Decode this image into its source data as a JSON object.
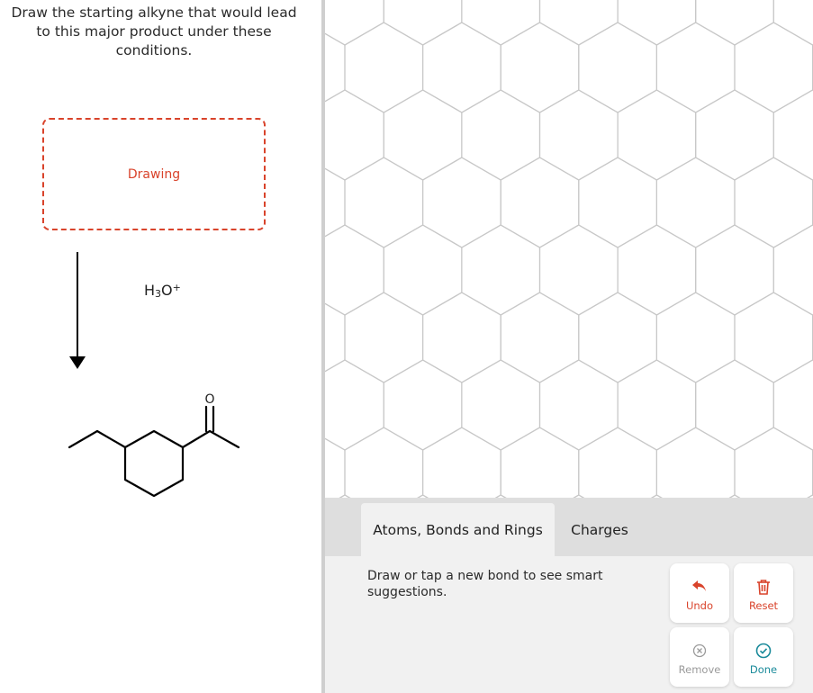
{
  "question": {
    "text": "Draw the starting alkyne that would lead to this major product under these conditions."
  },
  "drawing_box": {
    "label": "Drawing"
  },
  "reagent": {
    "main": "H",
    "sub": "3",
    "main2": "O",
    "sup": "+"
  },
  "product": {
    "atom_label": "O"
  },
  "tabs": [
    {
      "label": "Atoms, Bonds and Rings",
      "active": true
    },
    {
      "label": "Charges",
      "active": false
    }
  ],
  "hint": {
    "text": "Draw or tap a new bond to see smart suggestions."
  },
  "buttons": {
    "undo": {
      "label": "Undo",
      "icon": "undo-arrow-icon",
      "color": "#d9432b"
    },
    "reset": {
      "label": "Reset",
      "icon": "trash-icon",
      "color": "#d9432b"
    },
    "remove": {
      "label": "Remove",
      "icon": "circle-x-icon",
      "color": "#9a9a9a"
    },
    "done": {
      "label": "Done",
      "icon": "circle-check-icon",
      "color": "#1a8a9a"
    }
  },
  "colors": {
    "accent": "#d9432b",
    "grid": "#c8c8c8",
    "panel": "#f1f1f1",
    "tabbar": "#dedede"
  }
}
